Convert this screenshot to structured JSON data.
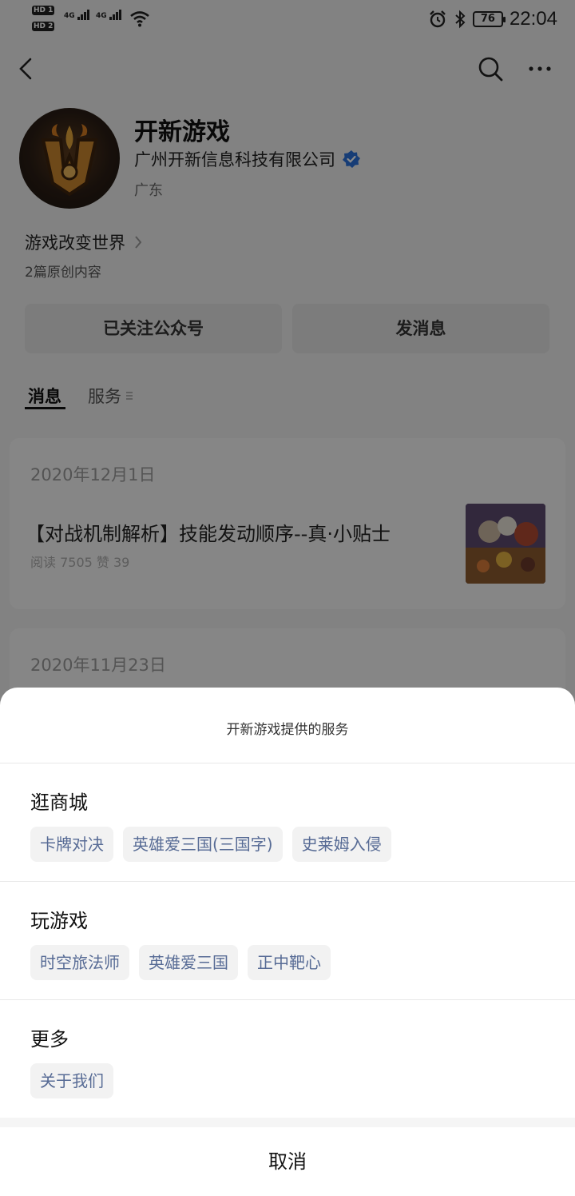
{
  "status_bar": {
    "hd1": "HD 1",
    "hd2": "HD 2",
    "net1": "4G",
    "net2": "4G",
    "battery": "76",
    "time": "22:04"
  },
  "profile": {
    "name": "开新游戏",
    "company": "广州开新信息科技有限公司",
    "region": "广东",
    "slogan": "游戏改变世界",
    "original_count": "2篇原创内容"
  },
  "actions": {
    "followed": "已关注公众号",
    "message": "发消息"
  },
  "tabs": {
    "messages": "消息",
    "services": "服务"
  },
  "articles": [
    {
      "date": "2020年12月1日",
      "title": "【对战机制解析】技能发动顺序--真·小贴士",
      "stats": "阅读 7505   赞 39"
    },
    {
      "date": "2020年11月23日"
    }
  ],
  "sheet": {
    "title": "开新游戏提供的服务",
    "sections": [
      {
        "title": "逛商城",
        "items": [
          "卡牌对决",
          "英雄爱三国(三国字)",
          "史莱姆入侵"
        ]
      },
      {
        "title": "玩游戏",
        "items": [
          "时空旅法师",
          "英雄爱三国",
          "正中靶心"
        ]
      },
      {
        "title": "更多",
        "items": [
          "关于我们"
        ]
      }
    ],
    "cancel": "取消"
  },
  "colors": {
    "link_chip_text": "#576b95",
    "verified_badge": "#2b6fd8"
  }
}
